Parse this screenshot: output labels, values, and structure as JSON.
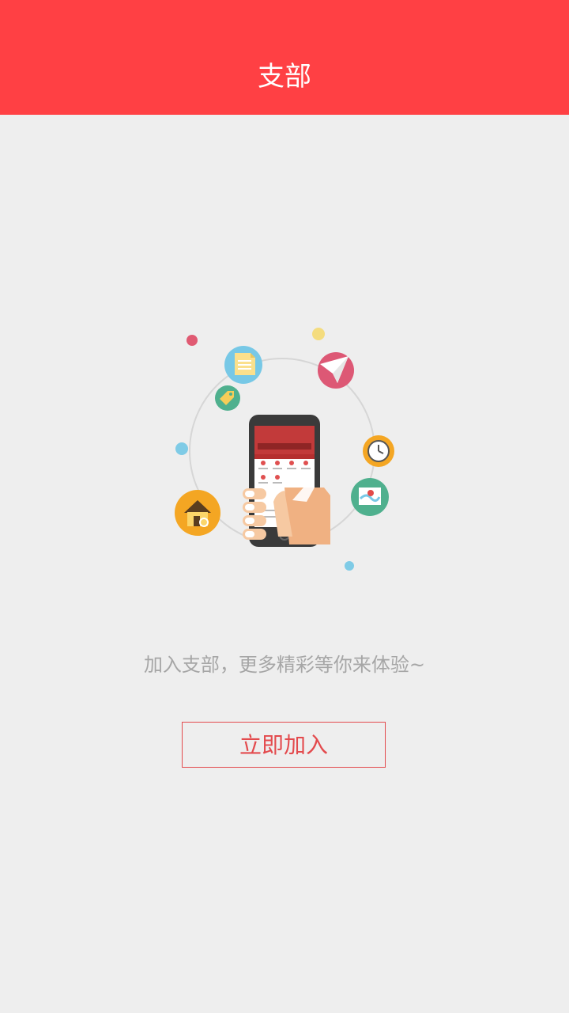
{
  "header": {
    "title": "支部"
  },
  "main": {
    "tagline": "加入支部，更多精彩等你来体验~",
    "join_button_label": "立即加入"
  },
  "illustration": {
    "icons": [
      "document-icon",
      "tag-icon",
      "paper-plane-icon",
      "clock-icon",
      "map-icon",
      "home-icon",
      "phone-icon",
      "hand-icon"
    ]
  },
  "colors": {
    "header_bg": "#ff4044",
    "page_bg": "#eeeeee",
    "accent": "#e34a4d",
    "tagline": "#a6a6a6"
  }
}
